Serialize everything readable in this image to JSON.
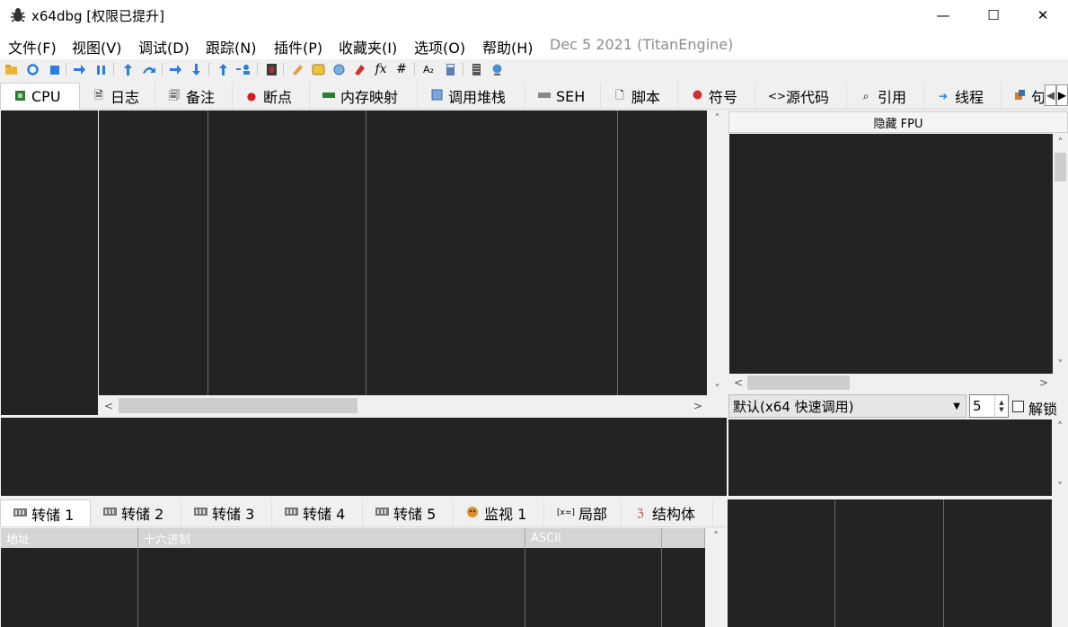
{
  "window": {
    "title": "x64dbg [权限已提升]",
    "app_icon": "bug-icon",
    "minimize": "—",
    "maximize": "☐",
    "close": "✕"
  },
  "menu": {
    "file": "文件(F)",
    "view": "视图(V)",
    "debug": "调试(D)",
    "trace": "跟踪(N)",
    "plugins": "插件(P)",
    "favourites": "收藏夹(I)",
    "options": "选项(O)",
    "help": "帮助(H)",
    "build_date": "Dec 5 2021 (TitanEngine)"
  },
  "toolbar": {
    "icons": [
      "open-icon",
      "restart-icon",
      "stop-icon",
      "run-icon",
      "pause-icon",
      "step-into-icon",
      "step-over-icon",
      "run-to-user-icon",
      "execute-till-return-icon",
      "step-out-icon",
      "attach-icon",
      "scylla-icon",
      "patch-icon",
      "comments-icon",
      "labels-icon",
      "bookmarks-icon",
      "functions-icon",
      "hash-icon",
      "strings-icon",
      "calculator-icon",
      "plugin-globe-icon"
    ],
    "fx": "fx",
    "hash": "#",
    "az": "A₂"
  },
  "tabs": [
    {
      "label": "CPU",
      "icon": "cpu-icon"
    },
    {
      "label": "日志",
      "icon": "log-icon"
    },
    {
      "label": "备注",
      "icon": "notes-icon"
    },
    {
      "label": "断点",
      "icon": "breakpoint-icon"
    },
    {
      "label": "内存映射",
      "icon": "memory-map-icon"
    },
    {
      "label": "调用堆栈",
      "icon": "call-stack-icon"
    },
    {
      "label": "SEH",
      "icon": "seh-icon"
    },
    {
      "label": "脚本",
      "icon": "script-icon"
    },
    {
      "label": "符号",
      "icon": "symbols-icon"
    },
    {
      "label": "源代码",
      "icon": "source-icon"
    },
    {
      "label": "引用",
      "icon": "references-icon"
    },
    {
      "label": "线程",
      "icon": "threads-icon"
    },
    {
      "label": "句",
      "icon": "handles-icon"
    }
  ],
  "registers": {
    "header": "隐藏 FPU"
  },
  "calling_convention": {
    "selected": "默认(x64 快速调用)",
    "arg_count": "5",
    "unlock_label": "解锁"
  },
  "dump_tabs": [
    {
      "label": "转储 1",
      "icon": "dump-icon"
    },
    {
      "label": "转储 2",
      "icon": "dump-icon"
    },
    {
      "label": "转储 3",
      "icon": "dump-icon"
    },
    {
      "label": "转储 4",
      "icon": "dump-icon"
    },
    {
      "label": "转储 5",
      "icon": "dump-icon"
    },
    {
      "label": "监视 1",
      "icon": "watch-icon"
    },
    {
      "label": "局部",
      "icon": "locals-icon"
    },
    {
      "label": "结构体",
      "icon": "struct-icon"
    }
  ],
  "dump_columns": [
    "地址",
    "十六进制",
    "ASCII"
  ]
}
